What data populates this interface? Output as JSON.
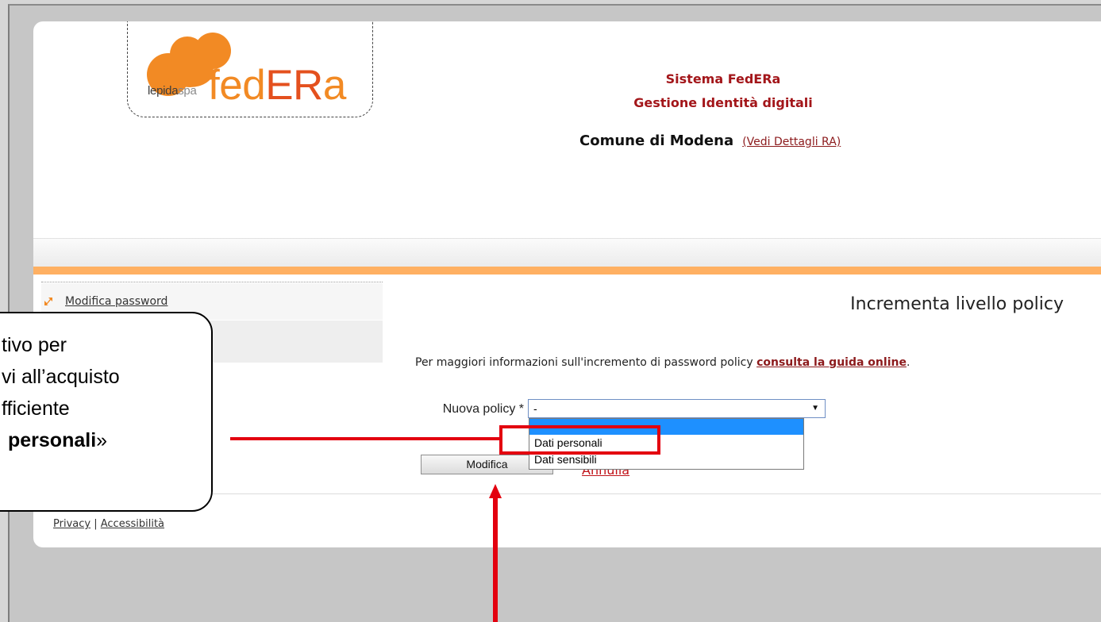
{
  "colors": {
    "brand_orange": "#f28a24",
    "brand_red": "#e4501e",
    "title_red": "#a3161a",
    "link_red": "#8c1a1c",
    "stripe_orange": "#ffb062",
    "highlight_blue": "#1e90ff",
    "annotation_red": "#e3000f"
  },
  "logo": {
    "icon": "lepida-blob-logo",
    "lepida": "lepida",
    "spa": "spa",
    "fed": "fed",
    "er": "ER",
    "a": "a"
  },
  "header": {
    "title": "Sistema FedERa",
    "subtitle": "Gestione Identità digitali",
    "entity": "Comune di Modena",
    "details_link": "(Vedi Dettagli RA)"
  },
  "sidebar": {
    "items": [
      {
        "label": "Modifica password",
        "icon": "arrow-icon"
      }
    ]
  },
  "main": {
    "heading": "Incrementa livello policy",
    "info_text": "Per maggiori informazioni sull'incremento di password policy ",
    "info_link": "consulta la guida online",
    "info_end": ".",
    "policy": {
      "label": "Nuova policy *",
      "selected": "-",
      "arrow_icon": "chevron-down-icon",
      "options": [
        {
          "label": "-",
          "highlighted": true
        },
        {
          "label": "Dati personali",
          "highlighted": false
        },
        {
          "label": "Dati sensibili",
          "highlighted": false
        }
      ]
    },
    "submit_label": "Modifica",
    "cancel_label": "Annulla"
  },
  "footer": {
    "privacy": "Privacy",
    "separator": "|",
    "accessibility": "Accessibilità"
  },
  "annotation": {
    "lines": [
      "tivo per",
      "vi all’acquisto",
      "fficiente"
    ],
    "bold": "personali",
    "suffix": "»"
  }
}
